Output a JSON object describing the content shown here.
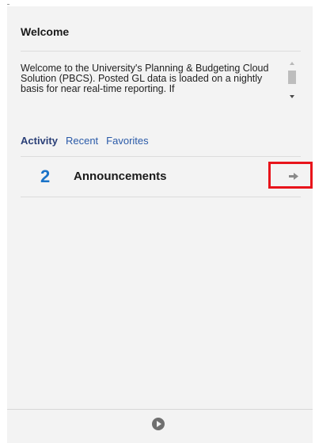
{
  "welcome": {
    "title": "Welcome",
    "text": "Welcome to the University's Planning & Budgeting Cloud Solution (PBCS).  Posted GL data is loaded on a nightly basis for near real-time reporting.  If"
  },
  "tabs": [
    {
      "label": "Activity",
      "active": true
    },
    {
      "label": "Recent",
      "active": false
    },
    {
      "label": "Favorites",
      "active": false
    }
  ],
  "announcements": {
    "count": "2",
    "label": "Announcements"
  },
  "icons": {
    "arrow": "arrow-right-icon",
    "play": "play-icon",
    "scroll_up": "chevron-up-icon",
    "scroll_down": "chevron-down-icon"
  },
  "colors": {
    "highlight_border": "#e8141b",
    "count": "#1a73c8",
    "tab_link": "#2a5aa8"
  }
}
